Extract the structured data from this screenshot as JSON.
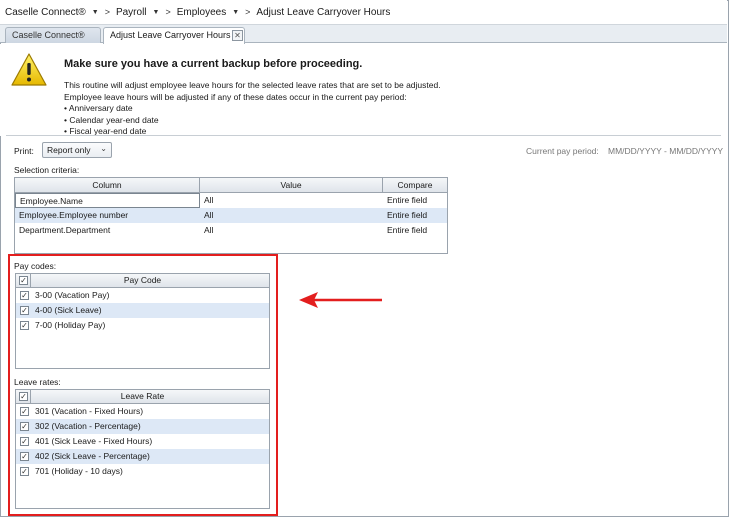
{
  "breadcrumb": {
    "items": [
      "Caselle Connect®",
      "Payroll",
      "Employees",
      "Adjust Leave Carryover Hours"
    ]
  },
  "tabs": [
    {
      "label": "Caselle Connect®"
    },
    {
      "label": "Adjust Leave Carryover Hours"
    }
  ],
  "warning": {
    "title": "Make sure you have a current backup before proceeding.",
    "line1": "This routine will adjust employee leave hours for the selected leave rates that are set to be adjusted.",
    "line2": "Employee leave hours will be adjusted if any of these dates occur in the current pay period:",
    "bullets": [
      "• Anniversary date",
      "• Calendar year-end date",
      "• Fiscal year-end date"
    ]
  },
  "print": {
    "label": "Print:",
    "value": "Report only"
  },
  "current_period": {
    "label": "Current pay period:",
    "value": "MM/DD/YYYY - MM/DD/YYYY"
  },
  "selection": {
    "label": "Selection criteria:",
    "headers": [
      "Column",
      "Value",
      "Compare"
    ],
    "rows": [
      [
        "Employee.Name",
        "All",
        "Entire field"
      ],
      [
        "Employee.Employee number",
        "All",
        "Entire field"
      ],
      [
        "Department.Department",
        "All",
        "Entire field"
      ]
    ]
  },
  "pay_codes": {
    "label": "Pay codes:",
    "header": "Pay Code",
    "items": [
      "3-00 (Vacation Pay)",
      "4-00 (Sick Leave)",
      "7-00 (Holiday Pay)"
    ]
  },
  "leave_rates": {
    "label": "Leave rates:",
    "header": "Leave Rate",
    "items": [
      "301 (Vacation - Fixed Hours)",
      "302 (Vacation - Percentage)",
      "401 (Sick Leave - Fixed Hours)",
      "402 (Sick Leave - Percentage)",
      "701 (Holiday - 10 days)"
    ]
  },
  "colors": {
    "highlight": "#e31e1e",
    "row_alt": "#dde8f6"
  },
  "icons": [
    "warning-icon",
    "close-icon",
    "chevron-down-icon",
    "checkbox-icon",
    "arrow-left-icon"
  ]
}
